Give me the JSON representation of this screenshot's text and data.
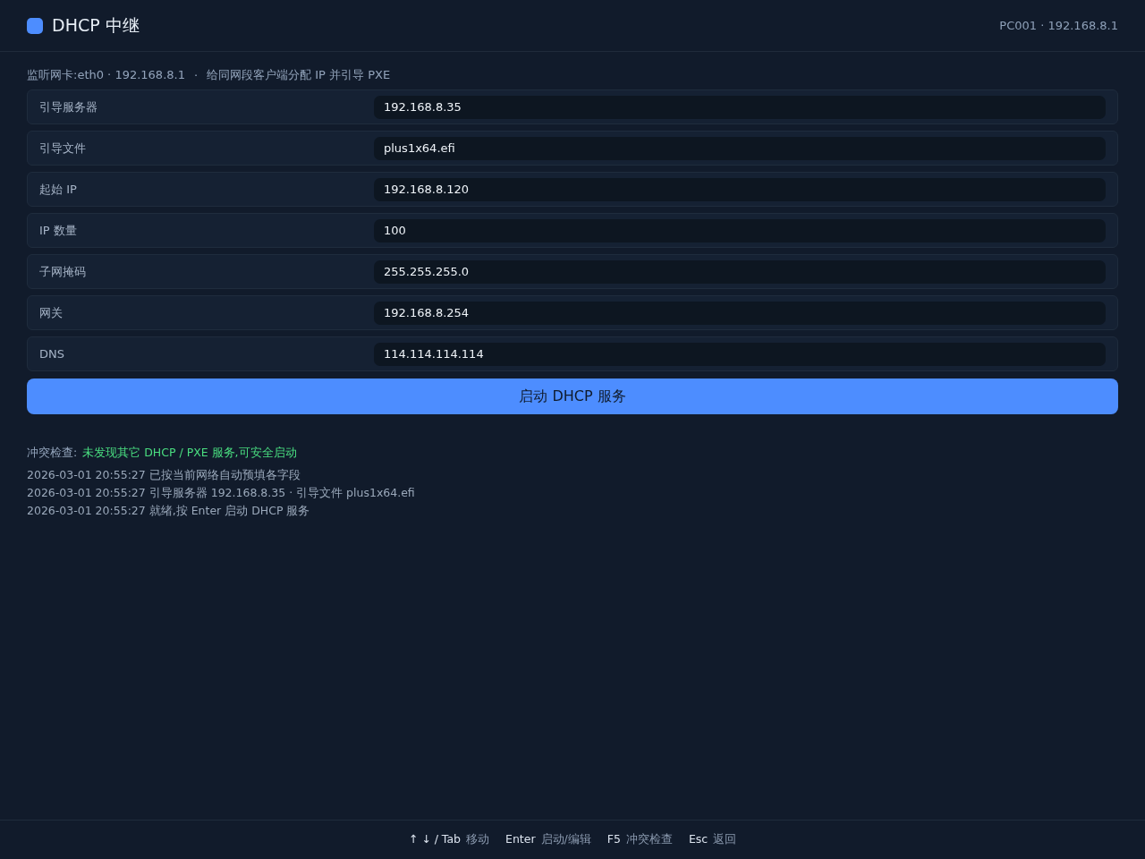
{
  "window": {
    "title": "DHCP 中继",
    "host": "PC001 · 192.168.8.1"
  },
  "subtitle": [
    "监听网卡:eth0 · 192.168.8.1",
    "·",
    "给同网段客户端分配 IP 并引导 PXE"
  ],
  "fields": [
    {
      "label": "引导服务器",
      "value": "192.168.8.35"
    },
    {
      "label": "引导文件",
      "value": "plus1x64.efi"
    },
    {
      "label": "起始 IP",
      "value": "192.168.8.120"
    },
    {
      "label": "IP 数量",
      "value": "100"
    },
    {
      "label": "子网掩码",
      "value": "255.255.255.0"
    },
    {
      "label": "网关",
      "value": "192.168.8.254"
    },
    {
      "label": "DNS",
      "value": "114.114.114.114"
    }
  ],
  "start_button": "启动 DHCP 服务",
  "conflict_check": {
    "label": "冲突检查:",
    "status": "未发现其它 DHCP / PXE 服务,可安全启动",
    "color": "#4ade80"
  },
  "log": [
    "2026-03-01 20:55:27 已按当前网络自动预填各字段",
    "2026-03-01 20:55:27 引导服务器 192.168.8.35 · 引导文件 plus1x64.efi",
    "2026-03-01 20:55:27 就绪,按 Enter 启动 DHCP 服务"
  ],
  "shortcuts": [
    {
      "key": "↑ ↓ / Tab",
      "action": "移动"
    },
    {
      "key": "Enter",
      "action": "启动/编辑"
    },
    {
      "key": "F5",
      "action": "冲突检查"
    },
    {
      "key": "Esc",
      "action": "返回"
    }
  ]
}
